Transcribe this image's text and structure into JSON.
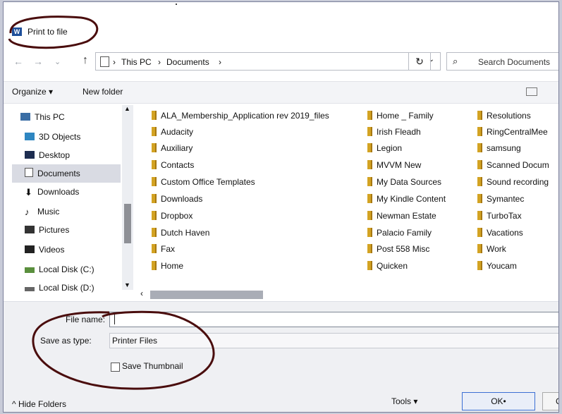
{
  "window": {
    "title": "Print to file",
    "app_icon": "W"
  },
  "nav": {
    "back": "←",
    "forward": "→",
    "recent": "⌄",
    "up": "↑"
  },
  "address": {
    "crumbs": [
      "This PC",
      "Documents"
    ],
    "separator": "›",
    "dropdown": "⌄",
    "refresh": "↻"
  },
  "search": {
    "placeholder": "Search Documents",
    "icon": "search-icon"
  },
  "toolbar": {
    "organize": "Organize ▾",
    "new_folder": "New folder"
  },
  "sidebar": {
    "items": [
      {
        "label": "This PC",
        "icon": "pc-icon"
      },
      {
        "label": "3D Objects",
        "icon": "cube-icon"
      },
      {
        "label": "Desktop",
        "icon": "desktop-icon"
      },
      {
        "label": "Documents",
        "icon": "document-icon",
        "selected": true
      },
      {
        "label": "Downloads",
        "icon": "download-icon"
      },
      {
        "label": "Music",
        "icon": "music-icon"
      },
      {
        "label": "Pictures",
        "icon": "pictures-icon"
      },
      {
        "label": "Videos",
        "icon": "video-icon"
      },
      {
        "label": "Local Disk (C:)",
        "icon": "disk-icon"
      },
      {
        "label": "Local Disk (D:)",
        "icon": "disk-icon"
      }
    ]
  },
  "files": {
    "col1": [
      "ALA_Membership_Application rev 2019_files",
      "Audacity",
      "Auxiliary",
      "Contacts",
      "Custom Office Templates",
      "Downloads",
      "Dropbox",
      "Dutch Haven",
      "Fax",
      "Home"
    ],
    "col2": [
      "Home _ Family",
      "Irish Fleadh",
      "Legion",
      "MVVM New",
      "My Data Sources",
      "My Kindle Content",
      "Newman Estate",
      "Palacio Family",
      "Post 558 Misc",
      "Quicken"
    ],
    "col3": [
      "Resolutions",
      "RingCentralMee",
      "samsung",
      "Scanned Docum",
      "Sound recording",
      "Symantec",
      "TurboTax",
      "Vacations",
      "Work",
      "Youcam"
    ]
  },
  "form": {
    "file_name_label": "File name:",
    "file_name_value": "",
    "save_type_label": "Save as type:",
    "save_type_value": "Printer Files",
    "thumbnail_label": "Save Thumbnail"
  },
  "footer": {
    "hide_folders": "^ Hide Folders",
    "tools": "Tools ▾",
    "ok": "OK•",
    "cancel": "Ca"
  },
  "colors": {
    "annotation": "#4a0d0d",
    "folder": "#d3a323",
    "selection": "#d9dbe3"
  }
}
